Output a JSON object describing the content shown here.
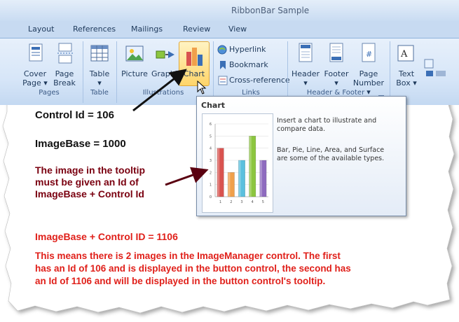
{
  "window": {
    "title": "RibbonBar Sample"
  },
  "tabs": [
    "Layout",
    "References",
    "Mailings",
    "Review",
    "View"
  ],
  "ribbon": {
    "groups": {
      "pages": "Pages",
      "table": "Table",
      "illustrations": "Illustrations",
      "links": "Links",
      "header_footer": "Header & Footer"
    },
    "buttons": {
      "cover_page": [
        "Cover",
        "Page ▾"
      ],
      "page_break": [
        "Page",
        "Break"
      ],
      "table": [
        "Table",
        "▾"
      ],
      "picture": "Picture",
      "graphics": "Graphi",
      "chart": "Chart",
      "hyperlink": "Hyperlink",
      "bookmark": "Bookmark",
      "cross_reference": "Cross-reference",
      "header": [
        "Header",
        "▾"
      ],
      "footer": [
        "Footer",
        "▾"
      ],
      "page_number": [
        "Page",
        "Number ▾"
      ],
      "text_box": [
        "Text",
        "Box ▾"
      ]
    }
  },
  "tooltip": {
    "title": "Chart",
    "line1": "Insert a chart to illustrate and",
    "line2": "compare data.",
    "line3": "Bar, Pie, Line, Area, and Surface",
    "line4": "are some of the available types.",
    "chart_data": {
      "type": "bar",
      "categories": [
        "1",
        "2",
        "3",
        "4",
        "5"
      ],
      "values": [
        4,
        2,
        3,
        5,
        3
      ],
      "ylim": [
        0,
        6
      ],
      "yticks": [
        "0",
        "1",
        "2",
        "3",
        "4",
        "5",
        "6"
      ],
      "colors": [
        "#d9534f",
        "#f0a04b",
        "#5bc0de",
        "#8cc63f",
        "#8e6bbf"
      ]
    }
  },
  "annotations": {
    "control_id": "Control Id = 106",
    "image_base": "ImageBase = 1000",
    "tooltip_note": [
      "The image in the tooltip",
      "must be given an Id of",
      "ImageBase + Control Id"
    ],
    "sum": "ImageBase + Control ID = 1106",
    "explanation": [
      "This means there is 2 images in the ImageManager control.  The first",
      "has an Id of 106 and is displayed in the button control, the second has",
      "an Id of 1106 and will be displayed in the button control's tooltip."
    ],
    "colors": {
      "dark": "#111111",
      "red": "#e0201a",
      "maroon": "#7a0010"
    }
  }
}
